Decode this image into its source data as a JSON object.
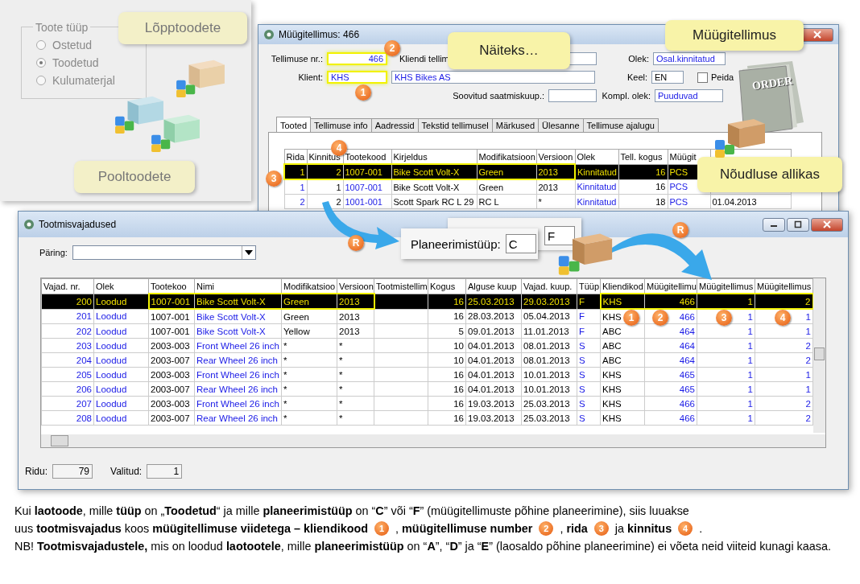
{
  "product_type_panel": {
    "group_title": "Toote tüüp",
    "options": [
      {
        "label": "Ostetud",
        "selected": false
      },
      {
        "label": "Toodetud",
        "selected": true
      },
      {
        "label": "Kulumaterjal",
        "selected": false
      }
    ]
  },
  "callouts": [
    {
      "text": "Lõpptoodete"
    },
    {
      "text": "Pooltoodete"
    },
    {
      "text": "Näiteks…"
    },
    {
      "text": "Müügitellimus"
    },
    {
      "text": "Nõudluse allikas"
    }
  ],
  "document_label": "ORDER",
  "sales_order_window": {
    "title": "Müügitellimus: 466",
    "fields": [
      {
        "label": "Tellimuse nr.:",
        "value": "466"
      },
      {
        "label": "Kliendi tellim"
      },
      {
        "label": "Olek:",
        "value": "Osal.kinnitatud"
      },
      {
        "label": "Klient:",
        "value": "KHS"
      },
      {
        "value": "KHS Bikes AS"
      },
      {
        "label": "Keel:",
        "value": "EN"
      },
      {
        "label": "Soovitud saatmiskuup.:"
      },
      {
        "label": "Kompl. olek:",
        "value": "Puuduvad"
      }
    ],
    "hide_checkbox": {
      "label": "Peida",
      "checked": false
    },
    "tabs": [
      {
        "label": "Tooted",
        "selected": true
      },
      {
        "label": "Tellimuse info",
        "selected": false
      },
      {
        "label": "Aadressid",
        "selected": false
      },
      {
        "label": "Tekstid tellimusel",
        "selected": false
      },
      {
        "label": "Märkused",
        "selected": false
      },
      {
        "label": "Ülesanne",
        "selected": false
      },
      {
        "label": "Tellimuse ajalugu",
        "selected": false
      }
    ],
    "table": {
      "columns": [
        "Rida",
        "Kinnitus",
        "Tootekood",
        "Kirjeldus",
        "Modifikatsioon",
        "Versioon",
        "Olek",
        "Tell. kogus",
        "Müügit",
        ""
      ],
      "rows": [
        {
          "selected": true,
          "cells": [
            "1",
            "2",
            "1007-001",
            "Bike Scott Volt-X",
            "Green",
            "2013",
            "Kinnitatud",
            "16",
            "PCS",
            ""
          ]
        },
        {
          "selected": false,
          "cells": [
            "1",
            "1",
            "1007-001",
            "Bike Scott Volt-X",
            "Green",
            "2013",
            "Kinnitatud",
            "16",
            "PCS",
            ""
          ]
        },
        {
          "selected": false,
          "cells": [
            "2",
            "2",
            "1001-001",
            "Scott Spark RC L 29",
            "RC L",
            "*",
            "Kinnitatud",
            "18",
            "PCS",
            "01.04.2013"
          ]
        }
      ]
    }
  },
  "planning_type": {
    "label": "Planeerimistüüp:",
    "value": "C",
    "alt_value": "F"
  },
  "requirements_window": {
    "title": "Tootmisvajadused",
    "query_label": "Päring:",
    "table": {
      "columns": [
        "Vajad. nr.",
        "Olek",
        "Tootekoo",
        "Nimi",
        "Modifikatsioo",
        "Versioon",
        "Tootmistellim",
        "Kogus",
        "Alguse kuup",
        "Vajad. kuup.",
        "Tüüp",
        "Kliendikod",
        "Müügitellimu",
        "Müügitellimus",
        "Müügitellimus"
      ],
      "rows": [
        {
          "selected": true,
          "cells": [
            "200",
            "Loodud",
            "1007-001",
            "Bike Scott Volt-X",
            "Green",
            "2013",
            "",
            "16",
            "25.03.2013",
            "29.03.2013",
            "F",
            "KHS",
            "466",
            "1",
            "2"
          ]
        },
        {
          "selected": false,
          "cells": [
            "201",
            "Loodud",
            "1007-001",
            "Bike Scott Volt-X",
            "Green",
            "2013",
            "",
            "16",
            "28.03.2013",
            "05.04.2013",
            "F",
            "KHS",
            "466",
            "1",
            "1"
          ]
        },
        {
          "selected": false,
          "cells": [
            "202",
            "Loodud",
            "1007-001",
            "Bike Scott Volt-X",
            "Yellow",
            "2013",
            "",
            "5",
            "09.01.2013",
            "11.01.2013",
            "F",
            "ABC",
            "464",
            "1",
            "1"
          ]
        },
        {
          "selected": false,
          "cells": [
            "203",
            "Loodud",
            "2003-003",
            "Front Wheel 26 inch",
            "*",
            "*",
            "",
            "10",
            "04.01.2013",
            "08.01.2013",
            "S",
            "ABC",
            "464",
            "1",
            "2"
          ]
        },
        {
          "selected": false,
          "cells": [
            "204",
            "Loodud",
            "2003-007",
            "Rear Wheel 26 inch",
            "*",
            "*",
            "",
            "10",
            "04.01.2013",
            "08.01.2013",
            "S",
            "ABC",
            "464",
            "1",
            "2"
          ]
        },
        {
          "selected": false,
          "cells": [
            "205",
            "Loodud",
            "2003-003",
            "Front Wheel 26 inch",
            "*",
            "*",
            "",
            "16",
            "04.01.2013",
            "10.01.2013",
            "S",
            "KHS",
            "465",
            "1",
            "1"
          ]
        },
        {
          "selected": false,
          "cells": [
            "206",
            "Loodud",
            "2003-007",
            "Rear Wheel 26 inch",
            "*",
            "*",
            "",
            "16",
            "04.01.2013",
            "10.01.2013",
            "S",
            "KHS",
            "465",
            "1",
            "1"
          ]
        },
        {
          "selected": false,
          "cells": [
            "207",
            "Loodud",
            "2003-003",
            "Front Wheel 26 inch",
            "*",
            "*",
            "",
            "16",
            "19.03.2013",
            "25.03.2013",
            "S",
            "KHS",
            "466",
            "1",
            "2"
          ]
        },
        {
          "selected": false,
          "cells": [
            "208",
            "Loodud",
            "2003-007",
            "Rear Wheel 26 inch",
            "*",
            "*",
            "",
            "16",
            "19.03.2013",
            "25.03.2013",
            "S",
            "KHS",
            "466",
            "1",
            "2"
          ]
        }
      ]
    },
    "status": [
      {
        "label": "Ridu:",
        "value": "79"
      },
      {
        "label": "Valitud:",
        "value": "1"
      }
    ]
  },
  "markers": [
    {
      "text": "2"
    },
    {
      "text": "1"
    },
    {
      "text": "4"
    },
    {
      "text": "3"
    },
    {
      "text": "R"
    },
    {
      "text": "R"
    },
    {
      "text": "1"
    },
    {
      "text": "2"
    },
    {
      "text": "3"
    },
    {
      "text": "4"
    }
  ],
  "caption": {
    "line_1": "Kui **laotoode**, mille **tüüp** on „**Toodetud**“ ja mille **planeerimistüüp** on “**C**” või “**F**” (müügitellimuste põhine planeerimine),  siis luuakse",
    "line_2": [
      {
        "kind": "text",
        "text": "uus **tootmisvajadus** koos **müügitellimuse viidetega – kliendikood**"
      },
      {
        "kind": "badge",
        "text": "1"
      },
      {
        "kind": "text",
        "text": ", **müügitellimuse number**"
      },
      {
        "kind": "badge",
        "text": "2"
      },
      {
        "kind": "text",
        "text": ", **rida**"
      },
      {
        "kind": "badge",
        "text": "3"
      },
      {
        "kind": "text",
        "text": "ja **kinnitus**"
      },
      {
        "kind": "badge",
        "text": "4"
      },
      {
        "kind": "text",
        "text": "."
      }
    ],
    "note": "NB! **Tootmisvajadustele,** mis on loodud **laotootele**, mille **planeerimistüüp** on “**A**”, “**D**” ja “**E**” (laosaldo põhine planeerimine) ei võeta neid viiteid kunagi kaasa."
  }
}
